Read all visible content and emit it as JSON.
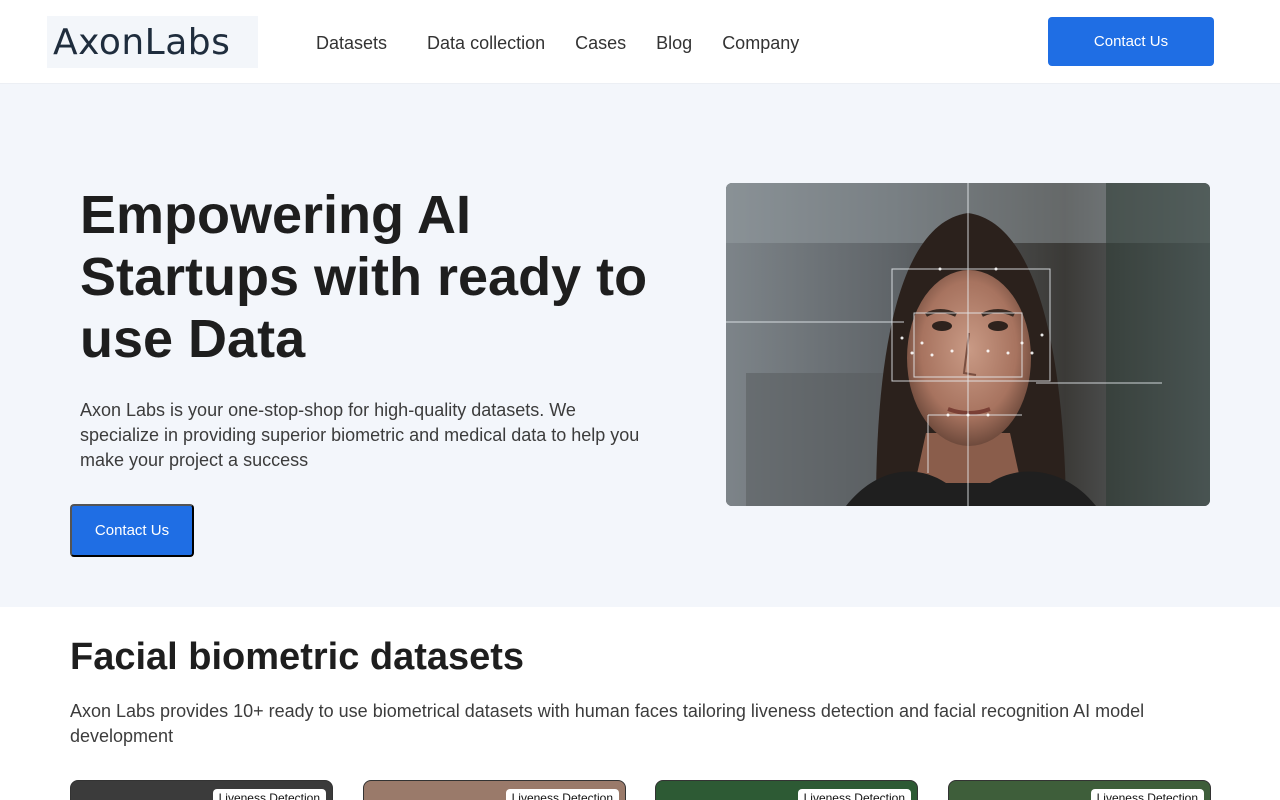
{
  "brand": {
    "logo_text": "AxonLabs"
  },
  "nav": {
    "items": [
      {
        "label": "Datasets"
      },
      {
        "label": "Data collection"
      },
      {
        "label": "Cases"
      },
      {
        "label": "Blog"
      },
      {
        "label": "Company"
      }
    ],
    "cta_label": "Contact Us"
  },
  "hero": {
    "title": "Empowering AI Startups with ready to use Data",
    "text": "Axon Labs is your one-stop-shop for high-quality datasets. We specialize in providing superior biometric and medical data to help you make your project a success",
    "cta_label": "Contact Us"
  },
  "datasets": {
    "title": "Facial biometric datasets",
    "text": "Axon Labs provides 10+ ready to use biometrical datasets with human faces tailoring liveness detection and facial recognition AI model development",
    "cards": [
      {
        "badge": "Liveness Detection",
        "color": "#3b3b3b"
      },
      {
        "badge": "Liveness Detection",
        "color": "#9a7a6a"
      },
      {
        "badge": "Liveness Detection",
        "color": "#2d5a34"
      },
      {
        "badge": "Liveness Detection",
        "color": "#3e5e3a"
      }
    ]
  },
  "colors": {
    "accent": "#1f6ee4",
    "hero_bg": "#f3f6fb"
  }
}
